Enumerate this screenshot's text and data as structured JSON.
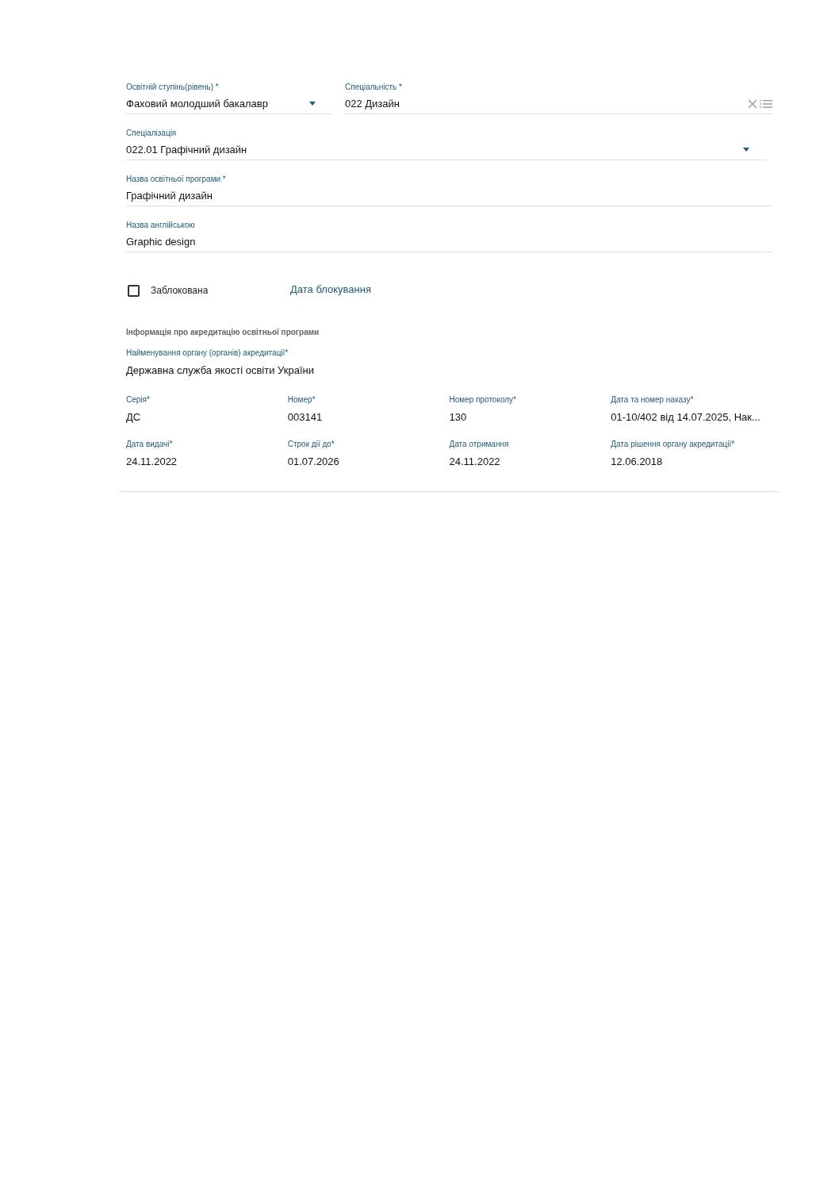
{
  "top_fields": [
    {
      "kind": "select",
      "label": "Освітній ступінь(рівень) *",
      "value": "Фаховий молодший бакалавр"
    },
    {
      "kind": "lookup",
      "label": "Спеціальність *",
      "value": "022 Дизайн"
    }
  ],
  "fields": [
    {
      "kind": "select",
      "label": "Спеціалізація",
      "value": "022.01 Графічний дизайн"
    },
    {
      "kind": "text",
      "label": "Назва освітньої програми *",
      "value": "Графічний дизайн"
    },
    {
      "kind": "text",
      "label": "Назва англійською",
      "value": "Graphic design"
    }
  ],
  "blocked": {
    "label": "Заблокована",
    "checked": false
  },
  "block_date_label": "Дата блокування",
  "accreditation": {
    "title": "Інформація про акредитацію освітньої програми",
    "body": {
      "label": "Найменування органу (органів) акредитації*",
      "value": "Державна служба якості освіти України"
    },
    "items": [
      {
        "label": "Серія*",
        "value": "ДС"
      },
      {
        "label": "Номер*",
        "value": "003141"
      },
      {
        "label": "Номер протоколу*",
        "value": "130"
      },
      {
        "label": "Дата та номер наказу*",
        "value": "01-10/402 від 14.07.2025, Нак..."
      },
      {
        "label": "Дата видачі*",
        "value": "24.11.2022"
      },
      {
        "label": "Строк дії до*",
        "value": "01.07.2026"
      },
      {
        "label": "Дата отримання",
        "value": "24.11.2022"
      },
      {
        "label": "Дата рішення органу акредитації*",
        "value": "12.06.2018"
      }
    ]
  }
}
